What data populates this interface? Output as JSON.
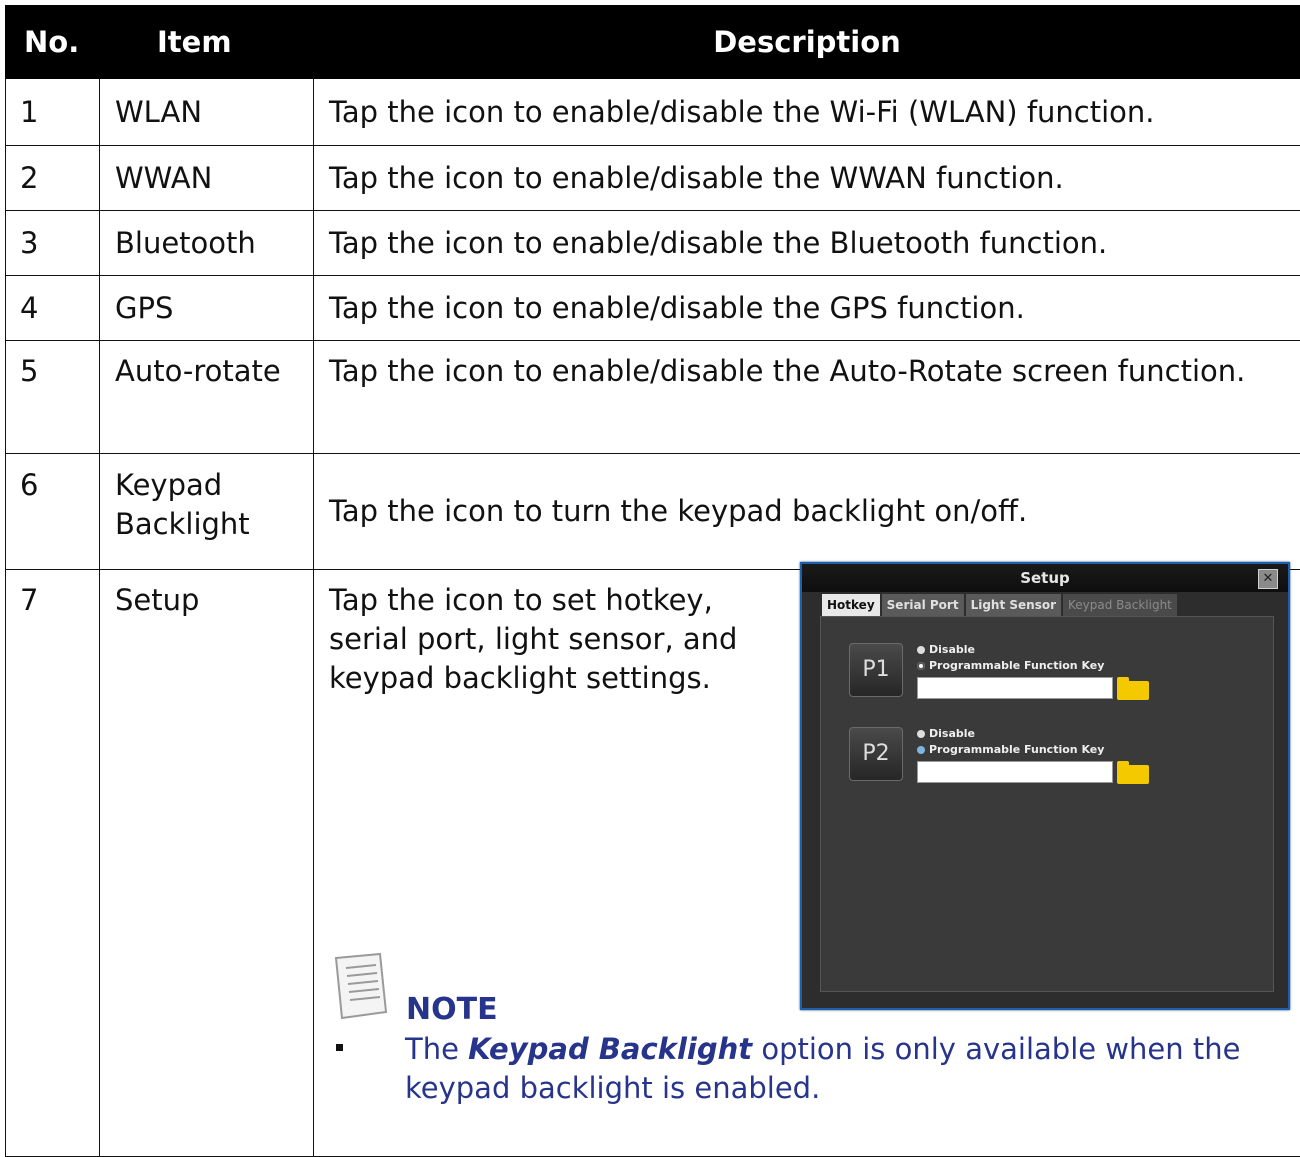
{
  "table": {
    "headers": {
      "no": "No.",
      "item": "Item",
      "description": "Description"
    },
    "rows": [
      {
        "no": "1",
        "item": "WLAN",
        "description": "Tap the icon to enable/disable the Wi-Fi (WLAN) function."
      },
      {
        "no": "2",
        "item": "WWAN",
        "description": "Tap the icon to enable/disable the WWAN function."
      },
      {
        "no": "3",
        "item": "Bluetooth",
        "description": "Tap the icon to enable/disable the Bluetooth function."
      },
      {
        "no": "4",
        "item": "GPS",
        "description": "Tap the icon to enable/disable the GPS function."
      },
      {
        "no": "5",
        "item": "Auto-rotate",
        "description": "Tap the icon to enable/disable the Auto-Rotate screen function."
      },
      {
        "no": "6",
        "item": "Keypad Backlight",
        "description": "Tap the icon to turn the keypad backlight on/off."
      },
      {
        "no": "7",
        "item": "Setup",
        "description": "Tap the icon to set hotkey, serial port, light sensor, and keypad backlight settings."
      }
    ]
  },
  "setup_dialog": {
    "title": "Setup",
    "close_glyph": "✕",
    "tabs": [
      "Hotkey",
      "Serial Port",
      "Light Sensor",
      "Keypad Backlight"
    ],
    "keys": [
      {
        "label": "P1",
        "option_disable": "Disable",
        "option_program": "Programmable Function Key"
      },
      {
        "label": "P2",
        "option_disable": "Disable",
        "option_program": "Programmable Function Key"
      }
    ]
  },
  "note": {
    "title": "NOTE",
    "text_before": "The ",
    "text_bold": "Keypad Backlight",
    "text_after": " option is only available when the keypad backlight is enabled.",
    "icon": "note-icon"
  },
  "colors": {
    "note_text": "#27348b",
    "header_bg": "#000000",
    "dialog_border": "#1d5fa8"
  }
}
